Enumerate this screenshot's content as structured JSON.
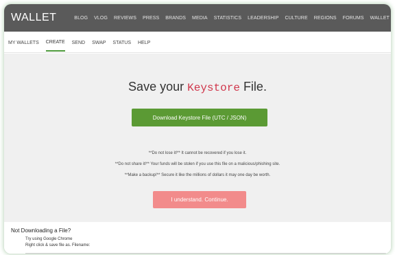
{
  "header": {
    "brand": "WALLET",
    "nav": [
      "BLOG",
      "VLOG",
      "REVIEWS",
      "PRESS",
      "BRANDS",
      "MEDIA",
      "STATISTICS",
      "LEADERSHIP",
      "CULTURE",
      "REGIONS",
      "FORUMS",
      "WALLET"
    ]
  },
  "subnav": {
    "items": [
      "MY WALLETS",
      "CREATE",
      "SEND",
      "SWAP",
      "STATUS",
      "HELP"
    ],
    "active": "CREATE"
  },
  "main": {
    "title_prefix": "Save your",
    "title_keyword": "Keystore",
    "title_suffix": "File.",
    "download_label": "Download Keystore File (UTC / JSON)",
    "warnings": [
      "**Do not lose it!** It cannot be recovered if you lose it.",
      "**Do not share it!** Your funds will be stolen if you use this file on a malicious/phishing site.",
      "**Make a backup!** Secure it like the millions of dollars it may one day be worth."
    ],
    "continue_label": "I understand. Continue."
  },
  "help": {
    "heading": "Not Downloading a File?",
    "line1": "Try using Google Chrome",
    "line2": "Right click & save file as. Filename:"
  },
  "colors": {
    "topbar": "#5a5a5a",
    "download_button": "#5b9a34",
    "continue_button": "#f28b8b",
    "keyword": "#d0364b",
    "active_underline": "#4e9a3c"
  }
}
